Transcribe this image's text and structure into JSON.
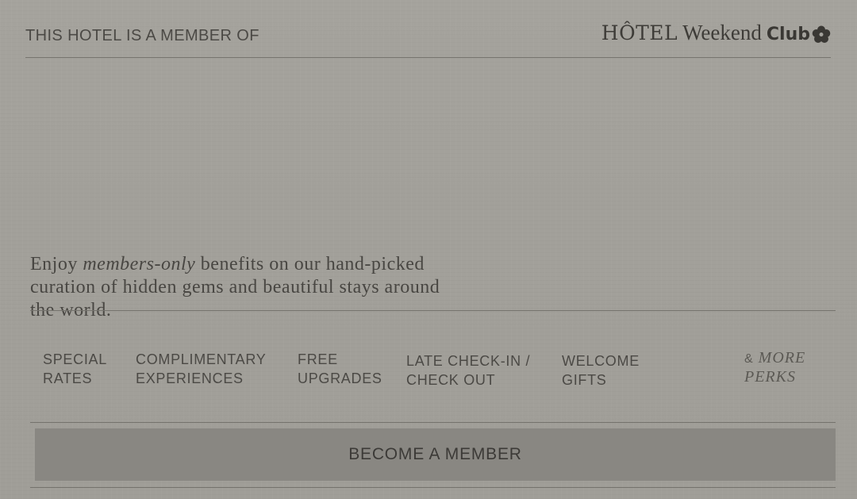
{
  "header": {
    "member_of": "THIS HOTEL IS A MEMBER OF",
    "logo": {
      "hotel": "HÔTEL",
      "weekend": "Weekend",
      "club": "Club",
      "icon": "flower-icon"
    }
  },
  "intro": {
    "before": "Enjoy ",
    "emphasis": "members-only",
    "after": " benefits on our hand-picked curation of hidden gems and beautiful stays around the world."
  },
  "perks": [
    {
      "line1": "SPECIAL",
      "line2": "RATES"
    },
    {
      "line1": "COMPLIMENTARY",
      "line2": "EXPERIENCES"
    },
    {
      "line1": "FREE",
      "line2": "UPGRADES"
    },
    {
      "line1": "LATE CHECK-IN /",
      "line2": "CHECK OUT"
    },
    {
      "line1": "WELCOME",
      "line2": "GIFTS"
    }
  ],
  "more_perks": {
    "amp": "&",
    "label_1": "MORE",
    "label_2": "PERKS"
  },
  "cta": {
    "label": "BECOME A MEMBER"
  },
  "colors": {
    "background": "#a3a19b",
    "text": "#4a4844",
    "button": "#898782",
    "rule": "#75736d"
  }
}
